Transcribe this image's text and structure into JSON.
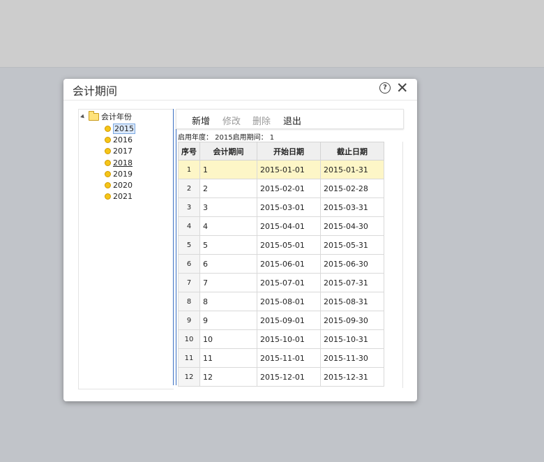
{
  "dialog": {
    "title": "会计期间"
  },
  "tree": {
    "root_label": "会计年份",
    "years": [
      {
        "label": "2015",
        "selected": true
      },
      {
        "label": "2016"
      },
      {
        "label": "2017"
      },
      {
        "label": "2018",
        "underline": true
      },
      {
        "label": "2019"
      },
      {
        "label": "2020"
      },
      {
        "label": "2021"
      }
    ]
  },
  "toolbar": {
    "add_label": "新增",
    "edit_label": "修改",
    "delete_label": "删除",
    "exit_label": "退出"
  },
  "info": {
    "text": "启用年度： 2015启用期间： 1"
  },
  "table": {
    "headers": [
      "序号",
      "会计期间",
      "开始日期",
      "截止日期"
    ],
    "rows": [
      [
        "1",
        "1",
        "2015-01-01",
        "2015-01-31"
      ],
      [
        "2",
        "2",
        "2015-02-01",
        "2015-02-28"
      ],
      [
        "3",
        "3",
        "2015-03-01",
        "2015-03-31"
      ],
      [
        "4",
        "4",
        "2015-04-01",
        "2015-04-30"
      ],
      [
        "5",
        "5",
        "2015-05-01",
        "2015-05-31"
      ],
      [
        "6",
        "6",
        "2015-06-01",
        "2015-06-30"
      ],
      [
        "7",
        "7",
        "2015-07-01",
        "2015-07-31"
      ],
      [
        "8",
        "8",
        "2015-08-01",
        "2015-08-31"
      ],
      [
        "9",
        "9",
        "2015-09-01",
        "2015-09-30"
      ],
      [
        "10",
        "10",
        "2015-10-01",
        "2015-10-31"
      ],
      [
        "11",
        "11",
        "2015-11-01",
        "2015-11-30"
      ],
      [
        "12",
        "12",
        "2015-12-01",
        "2015-12-31"
      ]
    ]
  }
}
